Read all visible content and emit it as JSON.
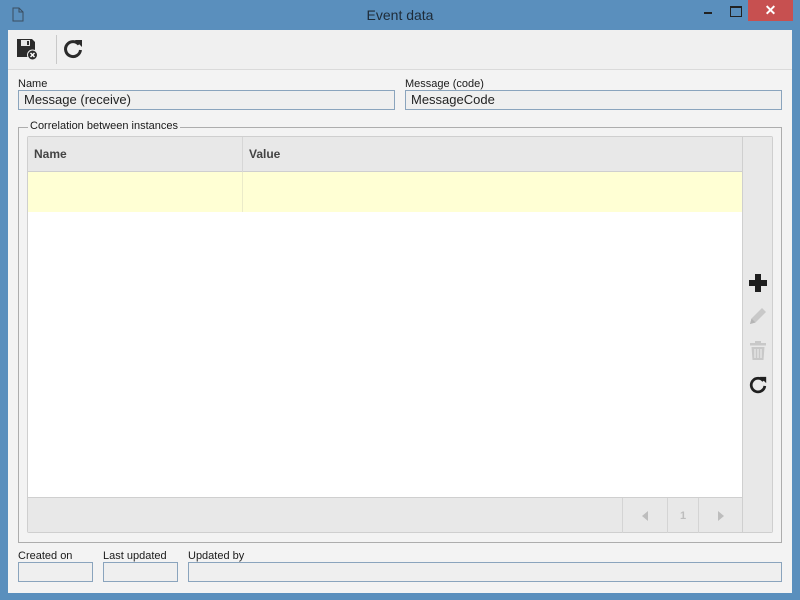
{
  "window": {
    "title": "Event data",
    "icon": "document-icon",
    "controls": {
      "minimize": "minimize",
      "maximize": "maximize",
      "close": "✕"
    },
    "colors": {
      "frame": "#5a8fbd",
      "close": "#c75050"
    }
  },
  "toolbar": {
    "buttons": [
      {
        "name": "save-and-close",
        "icon": "save-close-icon"
      },
      {
        "name": "refresh",
        "icon": "refresh-icon"
      }
    ]
  },
  "form": {
    "name": {
      "label": "Name",
      "value": "Message (receive)"
    },
    "message_code": {
      "label": "Message (code)",
      "value": "MessageCode"
    }
  },
  "correlation": {
    "legend": "Correlation between instances",
    "columns": [
      "Name",
      "Value"
    ],
    "rows": [
      {
        "name": "",
        "value": ""
      }
    ],
    "side_actions": [
      {
        "name": "add",
        "icon": "plus-icon",
        "enabled": true
      },
      {
        "name": "edit",
        "icon": "pencil-icon",
        "enabled": false
      },
      {
        "name": "delete",
        "icon": "trash-icon",
        "enabled": false
      },
      {
        "name": "refresh",
        "icon": "refresh-icon",
        "enabled": true
      }
    ],
    "pager": {
      "prev": "◀",
      "page": "1",
      "next": "▶"
    },
    "selected_row_color": "#ffffd4"
  },
  "footer": {
    "created_on": {
      "label": "Created on",
      "value": ""
    },
    "last_updated": {
      "label": "Last updated",
      "value": ""
    },
    "updated_by": {
      "label": "Updated by",
      "value": ""
    }
  }
}
